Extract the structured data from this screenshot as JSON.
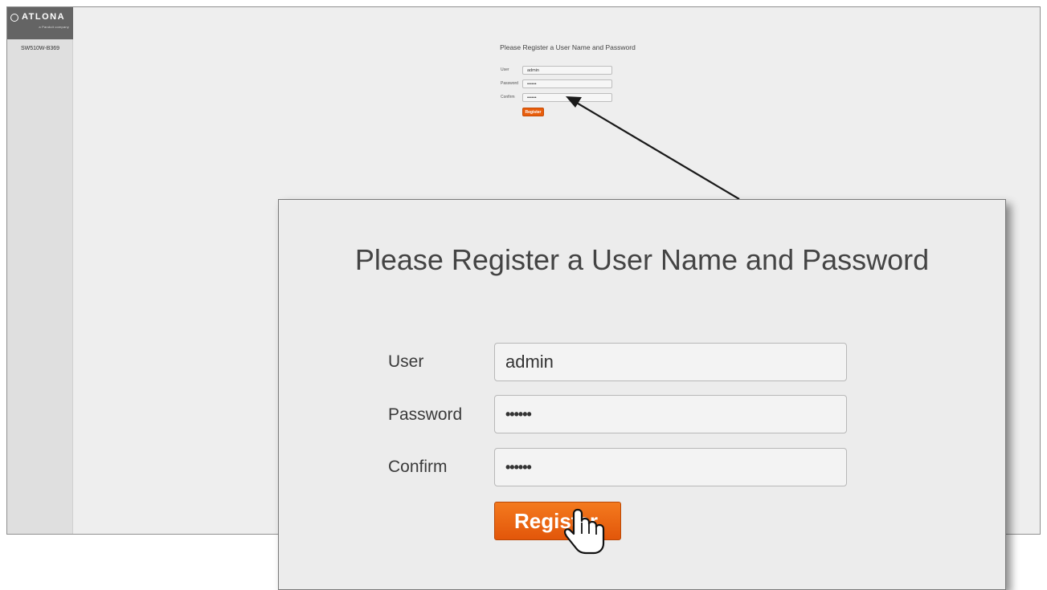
{
  "brand": {
    "name": "ATLONA",
    "tagline": "a Panduit company"
  },
  "sidebar": {
    "device_name": "SW510W-B369"
  },
  "page": {
    "title": "Please Register a User Name and Password",
    "fields": [
      {
        "label": "User",
        "value": "admin"
      },
      {
        "label": "Password",
        "value": "••••••"
      },
      {
        "label": "Confirm",
        "value": "••••••"
      }
    ],
    "register_label": "Register"
  },
  "colors": {
    "accent": "#e85d0b",
    "sidebar_bg": "#dfdfdf",
    "logo_bg": "#646464",
    "page_bg": "#eeeeee"
  },
  "icons": {
    "cursor": "hand-pointer-icon",
    "logo": "atlona-logo-icon"
  }
}
